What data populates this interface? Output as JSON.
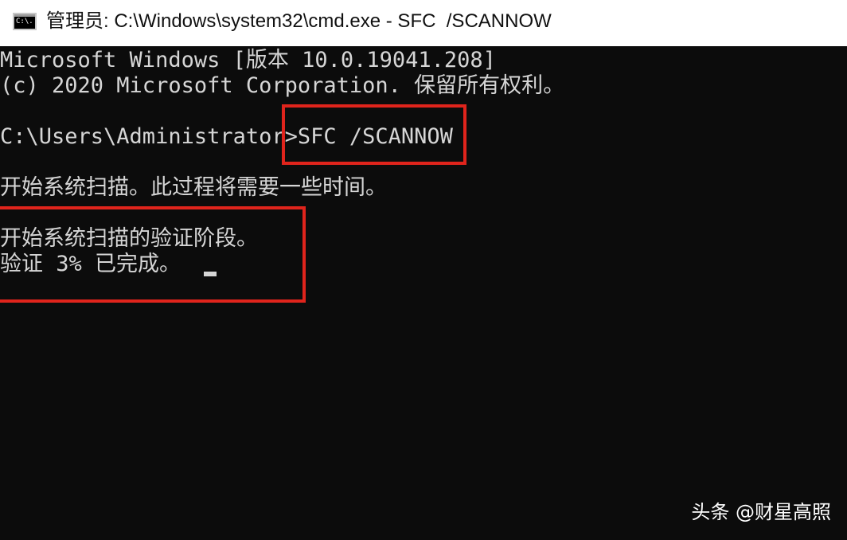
{
  "window": {
    "title": "管理员: C:\\Windows\\system32\\cmd.exe - SFC  /SCANNOW",
    "icon": "cmd-console-icon",
    "icon_text": "C:\\."
  },
  "console": {
    "lines": [
      "Microsoft Windows [版本 10.0.19041.208]",
      "(c) 2020 Microsoft Corporation. 保留所有权利。",
      "",
      "C:\\Users\\Administrator>SFC /SCANNOW",
      "",
      "开始系统扫描。此过程将需要一些时间。",
      "",
      "开始系统扫描的验证阶段。",
      "验证 3% 已完成。"
    ],
    "text_color": "#d6d6d6",
    "background": "#0c0c0c"
  },
  "progress": {
    "percent": 3
  },
  "annotations": {
    "highlight_color": "#e0241c"
  },
  "watermark": {
    "text": "头条 @财星高照"
  }
}
